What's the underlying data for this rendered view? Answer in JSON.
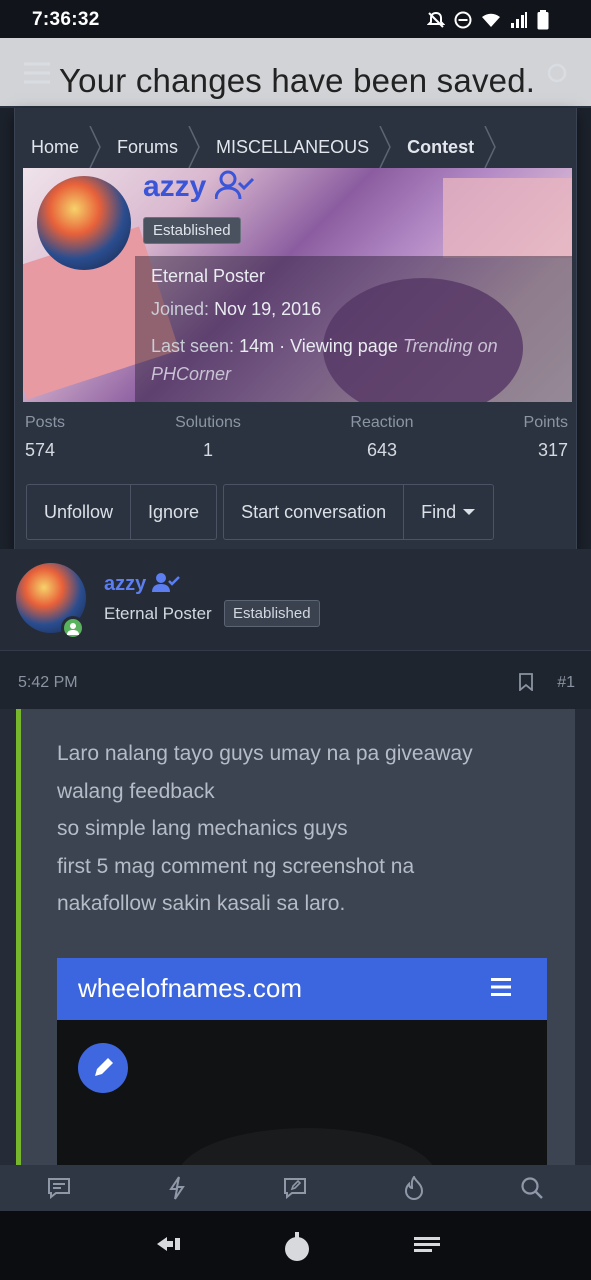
{
  "status_bar": {
    "time": "7:36:32"
  },
  "toast": {
    "message": "Your changes have been saved."
  },
  "breadcrumb": [
    "Home",
    "Forums",
    "MISCELLANEOUS",
    "Contest"
  ],
  "profile": {
    "name": "azzy",
    "badge": "Established",
    "title": "Eternal Poster",
    "joined_label": "Joined:",
    "joined_value": "Nov 19, 2016",
    "last_seen_label": "Last seen:",
    "last_seen_value": "14m · Viewing page",
    "last_seen_page": "Trending on PHCorner",
    "stats": [
      {
        "label": "Posts",
        "value": "574"
      },
      {
        "label": "Solutions",
        "value": "1"
      },
      {
        "label": "Reaction",
        "value": "643"
      },
      {
        "label": "Points",
        "value": "317"
      }
    ],
    "actions": {
      "unfollow": "Unfollow",
      "ignore": "Ignore",
      "start_conversation": "Start conversation",
      "find": "Find"
    }
  },
  "post": {
    "author": "azzy",
    "author_title": "Eternal Poster",
    "author_badge": "Established",
    "time": "5:42 PM",
    "number": "#1",
    "lines": [
      "Laro nalang tayo guys umay na pa giveaway",
      "walang feedback",
      "so simple lang mechanics guys",
      "first 5 mag comment ng screenshot na",
      "nakafollow sakin kasali sa laro."
    ],
    "embed_site": "wheelofnames.com"
  },
  "colors": {
    "accent": "#5c7ef0",
    "quote_bar": "#77b72c",
    "embed_bar": "#3c66e0"
  },
  "bottom_nav_icons": [
    "forums-icon",
    "whats-new-icon",
    "new-post-icon",
    "trending-icon",
    "search-icon"
  ]
}
